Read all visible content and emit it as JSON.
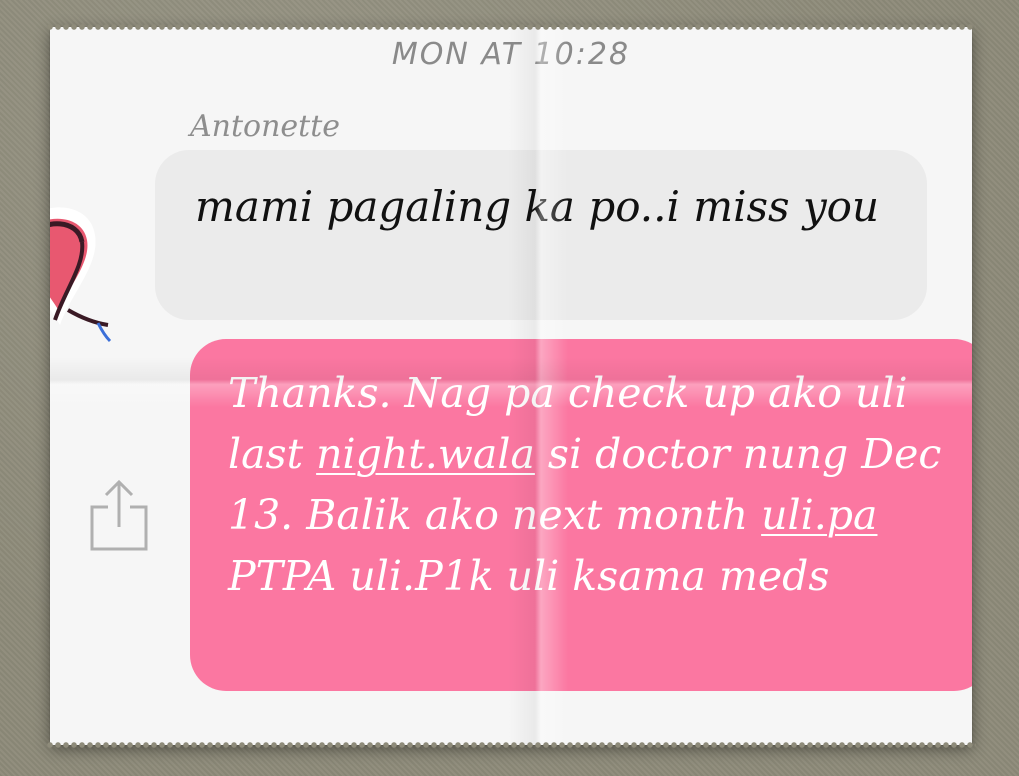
{
  "conversation": {
    "timestamp": "MON AT 10:28",
    "sender_name": "Antonette"
  },
  "incoming_message": {
    "text": "mami pagaling ka po..i miss you"
  },
  "outgoing_message": {
    "part1": "Thanks.  Nag pa check up ako uli last ",
    "link1": "night.wala",
    "part2": " si doctor nung Dec 13. Balik ako next month ",
    "link2": "uli.pa",
    "part3": " PTPA uli.P1k uli ksama meds"
  },
  "icons": {
    "share": "share-icon",
    "avatar": "heart-avatar-icon"
  },
  "colors": {
    "outgoing_bubble": "#fb77a1",
    "incoming_bubble": "#ebebeb",
    "heart": "#e85870"
  }
}
